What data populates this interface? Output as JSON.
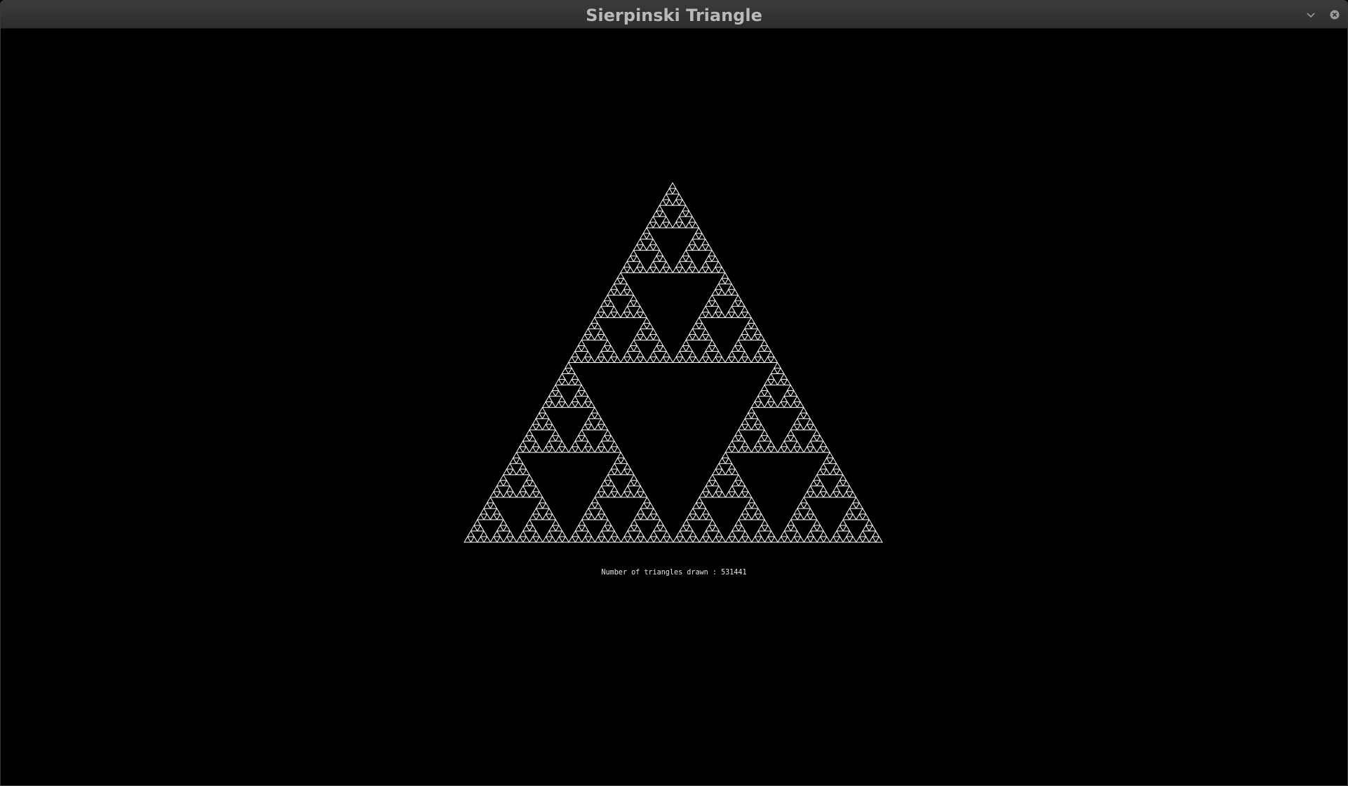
{
  "window": {
    "title": "Sierpinski Triangle",
    "controls": {
      "minimize_icon": "chevron-down-icon",
      "close_icon": "close-circle-icon"
    }
  },
  "canvas": {
    "background_color": "#000000",
    "fractal_color": "#ffffff",
    "caption": "Number of triangles drawn : 531441"
  }
}
